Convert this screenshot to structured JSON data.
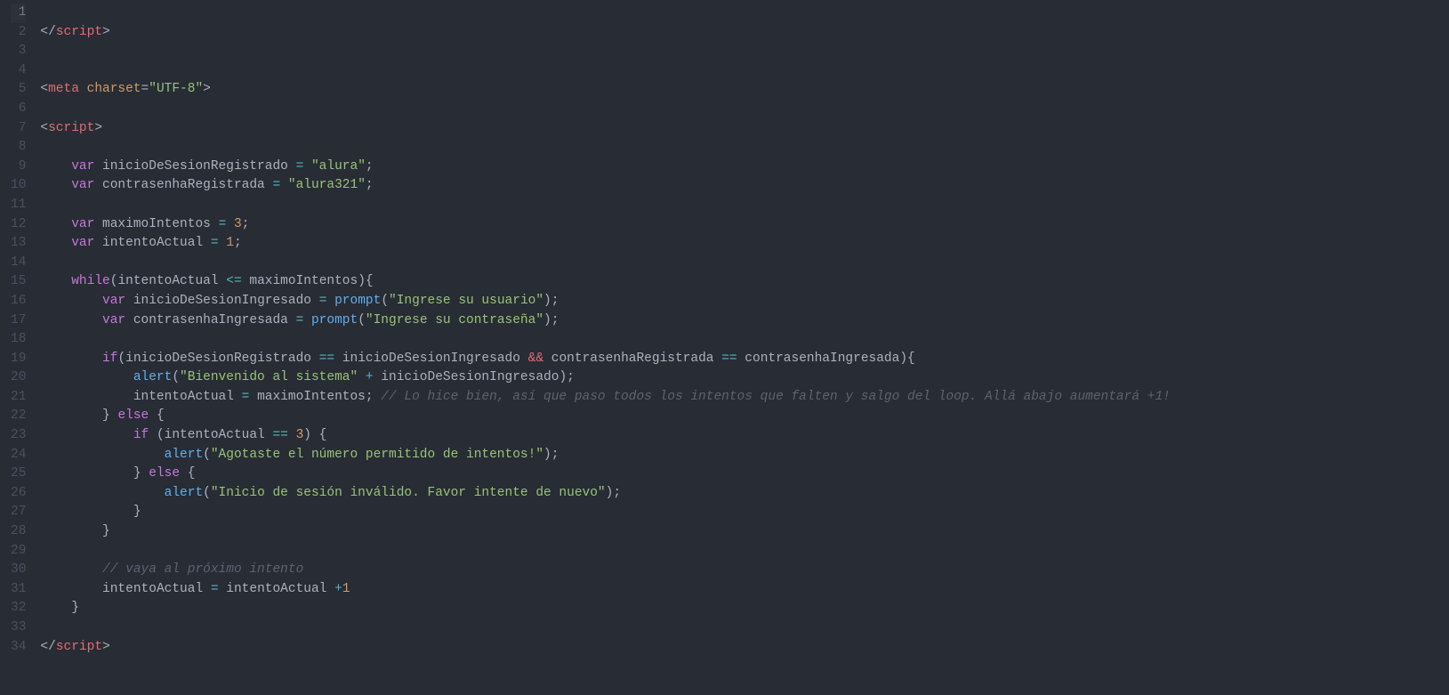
{
  "lineNumbers": [
    "1",
    "2",
    "3",
    "4",
    "5",
    "6",
    "7",
    "8",
    "9",
    "10",
    "11",
    "12",
    "13",
    "14",
    "15",
    "16",
    "17",
    "18",
    "19",
    "20",
    "21",
    "22",
    "23",
    "24",
    "25",
    "26",
    "27",
    "28",
    "29",
    "30",
    "31",
    "32",
    "33",
    "34"
  ],
  "highlightedLine": 0,
  "code": {
    "l2": {
      "closeScript": "script"
    },
    "l5": {
      "meta": "meta",
      "charsetAttr": "charset",
      "charsetVal": "\"UTF-8\""
    },
    "l7": {
      "openScript": "script"
    },
    "l9": {
      "var": "var",
      "name": "inicioDeSesionRegistrado",
      "eq": "=",
      "val": "\"alura\""
    },
    "l10": {
      "var": "var",
      "name": "contrasenhaRegistrada",
      "eq": "=",
      "val": "\"alura321\""
    },
    "l12": {
      "var": "var",
      "name": "maximoIntentos",
      "eq": "=",
      "val": "3"
    },
    "l13": {
      "var": "var",
      "name": "intentoActual",
      "eq": "=",
      "val": "1"
    },
    "l15": {
      "while": "while",
      "a": "intentoActual",
      "op": "<=",
      "b": "maximoIntentos"
    },
    "l16": {
      "var": "var",
      "name": "inicioDeSesionIngresado",
      "eq": "=",
      "fn": "prompt",
      "arg": "\"Ingrese su usuario\""
    },
    "l17": {
      "var": "var",
      "name": "contrasenhaIngresada",
      "eq": "=",
      "fn": "prompt",
      "arg": "\"Ingrese su contraseña\""
    },
    "l19": {
      "if": "if",
      "a1": "inicioDeSesionRegistrado",
      "eq1": "==",
      "b1": "inicioDeSesionIngresado",
      "and": "&&",
      "a2": "contrasenhaRegistrada",
      "eq2": "==",
      "b2": "contrasenhaIngresada"
    },
    "l20": {
      "fn": "alert",
      "s": "\"Bienvenido al sistema\"",
      "plus": "+",
      "v": "inicioDeSesionIngresado"
    },
    "l21": {
      "a": "intentoActual",
      "eq": "=",
      "b": "maximoIntentos",
      "comment": "// Lo hice bien, así que paso todos los intentos que falten y salgo del loop. Allá abajo aumentará +1!"
    },
    "l22": {
      "else": "else"
    },
    "l23": {
      "if": "if",
      "a": "intentoActual",
      "eq": "==",
      "b": "3"
    },
    "l24": {
      "fn": "alert",
      "arg": "\"Agotaste el número permitido de intentos!\""
    },
    "l25": {
      "else": "else"
    },
    "l26": {
      "fn": "alert",
      "arg": "\"Inicio de sesión inválido. Favor intente de nuevo\""
    },
    "l30": {
      "comment": "// vaya al próximo intento"
    },
    "l31": {
      "a": "intentoActual",
      "eq": "=",
      "b": "intentoActual",
      "plus": "+",
      "n": "1"
    },
    "l34": {
      "closeScript": "script"
    }
  }
}
